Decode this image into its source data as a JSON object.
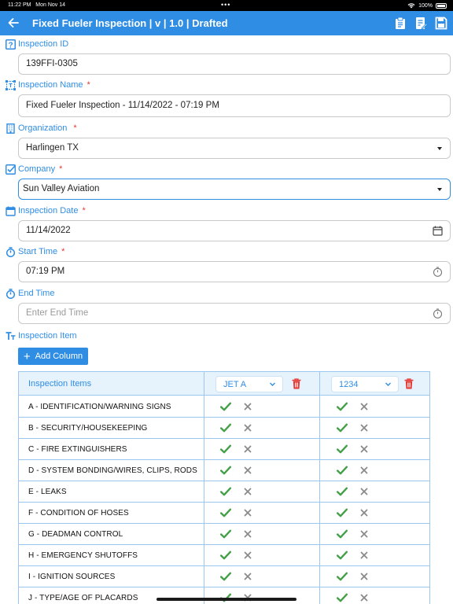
{
  "status_bar": {
    "time": "11:22 PM",
    "date": "Mon Nov 14",
    "battery": "100%"
  },
  "header": {
    "title": "Fixed Fueler Inspection | v | 1.0 | Drafted"
  },
  "form": {
    "inspection_id": {
      "label": "Inspection ID",
      "value": "139FFI-0305"
    },
    "inspection_name": {
      "label": "Inspection Name",
      "required": "*",
      "value": "Fixed Fueler Inspection - 11/14/2022 - 07:19 PM"
    },
    "organization": {
      "label": "Organization",
      "required": "*",
      "value": "Harlingen TX"
    },
    "company": {
      "label": "Company",
      "required": "*",
      "value": "Sun Valley Aviation"
    },
    "inspection_date": {
      "label": "Inspection Date",
      "required": "*",
      "value": "11/14/2022"
    },
    "start_time": {
      "label": "Start Time",
      "required": "*",
      "value": "07:19 PM"
    },
    "end_time": {
      "label": "End Time",
      "placeholder": "Enter End Time",
      "value": ""
    },
    "inspection_item": {
      "label": "Inspection Item"
    }
  },
  "add_column_label": "Add Column",
  "table": {
    "header_label": "Inspection Items",
    "columns": [
      {
        "selected": "JET A"
      },
      {
        "selected": "1234"
      }
    ],
    "rows": [
      "A - IDENTIFICATION/WARNING SIGNS",
      "B - SECURITY/HOUSEKEEPING",
      "C - FIRE EXTINGUISHERS",
      "D - SYSTEM BONDING/WIRES, CLIPS, RODS",
      "E - LEAKS",
      "F - CONDITION OF HOSES",
      "G - DEADMAN CONTROL",
      "H - EMERGENCY SHUTOFFS",
      "I - IGNITION SOURCES",
      "J - TYPE/AGE OF PLACARDS"
    ]
  },
  "icons": {
    "back": "arrow-left-icon",
    "toolbar": [
      "clipboard-icon",
      "document-edit-icon",
      "save-icon"
    ],
    "check": "check-icon",
    "cross": "close-icon",
    "delete": "trash-icon"
  },
  "colors": {
    "primary": "#2f8de4",
    "required": "#e53935",
    "pass": "#43a047",
    "fail": "#8a8a8a",
    "delete": "#e53935",
    "table_header": "#e6f3fd"
  }
}
